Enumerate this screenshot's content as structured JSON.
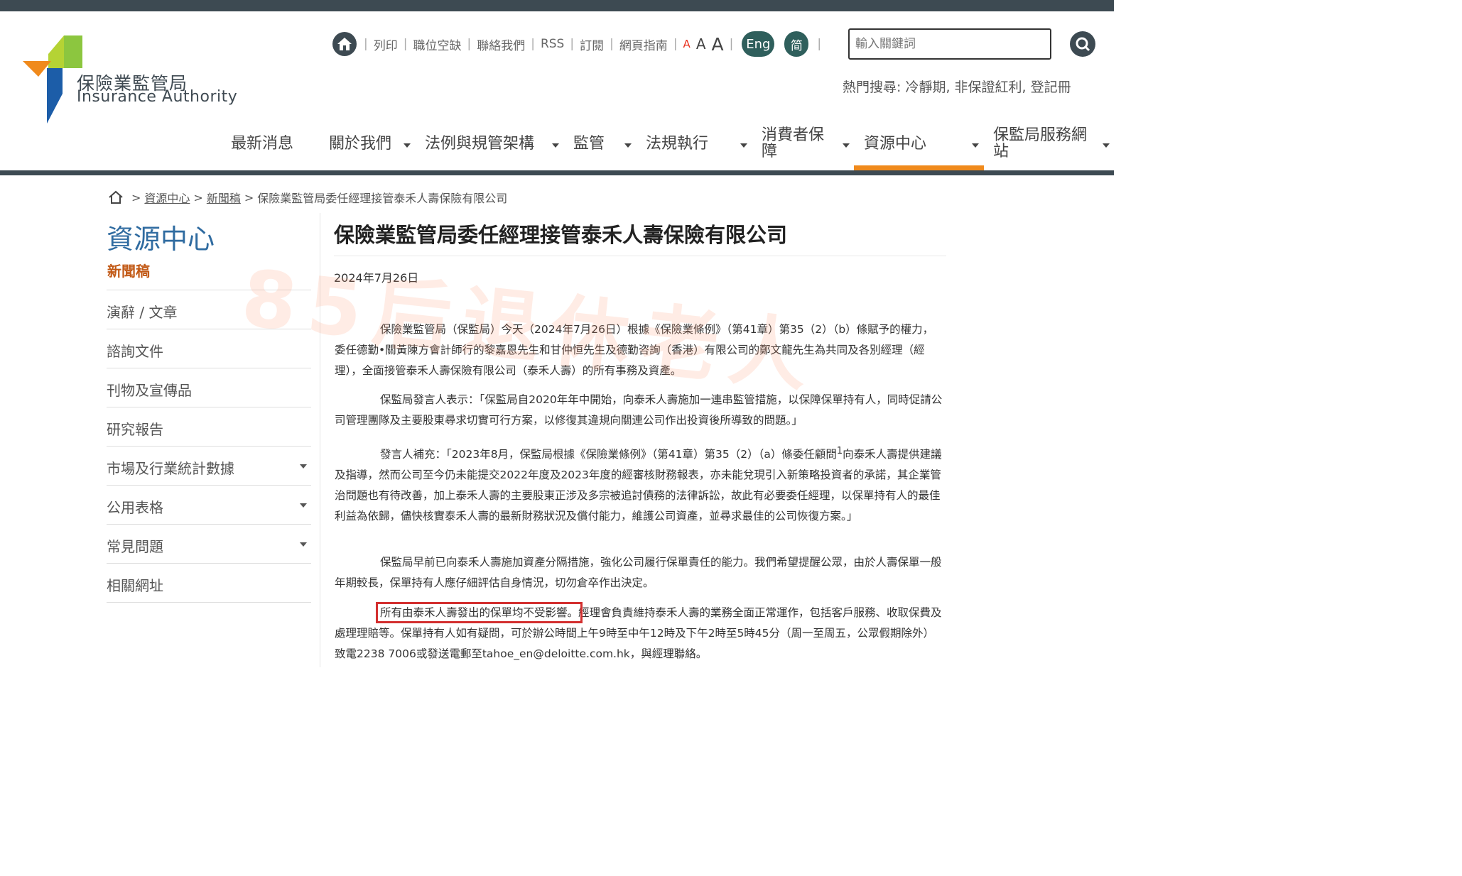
{
  "logo": {
    "cn": "保險業監管局",
    "en": "Insurance Authority"
  },
  "utility": {
    "links": [
      "列印",
      "職位空缺",
      "聯絡我們",
      "RSS",
      "訂閱",
      "網頁指南"
    ],
    "font_sizes": [
      "A",
      "A",
      "A"
    ],
    "lang_eng": "Eng",
    "lang_sc": "简"
  },
  "search": {
    "placeholder": "輸入關鍵詞"
  },
  "hot_search": "熱門搜尋: 冷靜期, 非保證紅利, 登記冊",
  "nav": [
    "最新消息",
    "關於我們",
    "法例與規管架構",
    "監管",
    "法規執行",
    "消費者保障",
    "資源中心",
    "保監局服務網站"
  ],
  "breadcrumb": {
    "sep": ">",
    "items": [
      "資源中心",
      "新聞稿"
    ],
    "current": "保險業監管局委任經理接管泰禾人壽保險有限公司"
  },
  "sidebar": {
    "title": "資源中心",
    "active": "新聞稿",
    "items": [
      "演辭 / 文章",
      "諮詢文件",
      "刊物及宣傳品",
      "研究報告",
      "市場及行業統計數據",
      "公用表格",
      "常見問題",
      "相關網址"
    ]
  },
  "article": {
    "title": "保險業監管局委任經理接管泰禾人壽保險有限公司",
    "date": "2024年7月26日",
    "p1": "保險業監管局（保監局）今天（2024年7月26日）根據《保險業條例》（第41章）第35（2）（b）條賦予的權力，委任德勤•關黃陳方會計師行的黎嘉恩先生和甘仲恒先生及德勤咨詢（香港）有限公司的鄭文龍先生為共同及各別經理（經理），全面接管泰禾人壽保險有限公司（泰禾人壽）的所有事務及資產。",
    "p2": "保監局發言人表示：「保監局自2020年年中開始，向泰禾人壽施加一連串監管措施，以保障保單持有人，同時促請公司管理團隊及主要股東尋求切實可行方案，以修復其違規向關連公司作出投資後所導致的問題。」",
    "p3a": "發言人補充：「2023年8月，保監局根據《保險業條例》（第41章）第35（2）（a）條委任顧問",
    "p3_sup": "1",
    "p3b": "向泰禾人壽提供建議及指導，然而公司至今仍未能提交2022年度及2023年度的經審核財務報表，亦未能兌現引入新策略投資者的承諾，其企業管治問題也有待改善，加上泰禾人壽的主要股東正涉及多宗被追討債務的法律訴訟，故此有必要委任經理，以保單持有人的最佳利益為依歸，儘快核實泰禾人壽的最新財務狀況及償付能力，維護公司資產，並尋求最佳的公司恢復方案。」",
    "p4": "保監局早前已向泰禾人壽施加資產分隔措施，強化公司履行保單責任的能力。我們希望提醒公眾，由於人壽保單一般年期較長，保單持有人應仔細評估自身情況，切勿倉卒作出決定。",
    "p5_highlight": "所有由泰禾人壽發出的保單均不受影響。",
    "p5_rest": "經理會負責維持泰禾人壽的業務全面正常運作，包括客戶服務、收取保費及處理理賠等。保單持有人如有疑問，可於辦公時間上午9時至中午12時及下午2時至5時45分（周一至周五，公眾假期除外）致電2238 7006或發送電郵至tahoe_en@deloitte.com.hk，與經理聯絡。"
  },
  "watermark": "85后退休老人",
  "colors": {
    "dark": "#3d4a52",
    "accent": "#f08a1c",
    "title_blue": "#2f6ba0",
    "active_orange": "#c25a17",
    "lang_green": "#2f5f5c",
    "highlight_red": "#d32f2f"
  }
}
